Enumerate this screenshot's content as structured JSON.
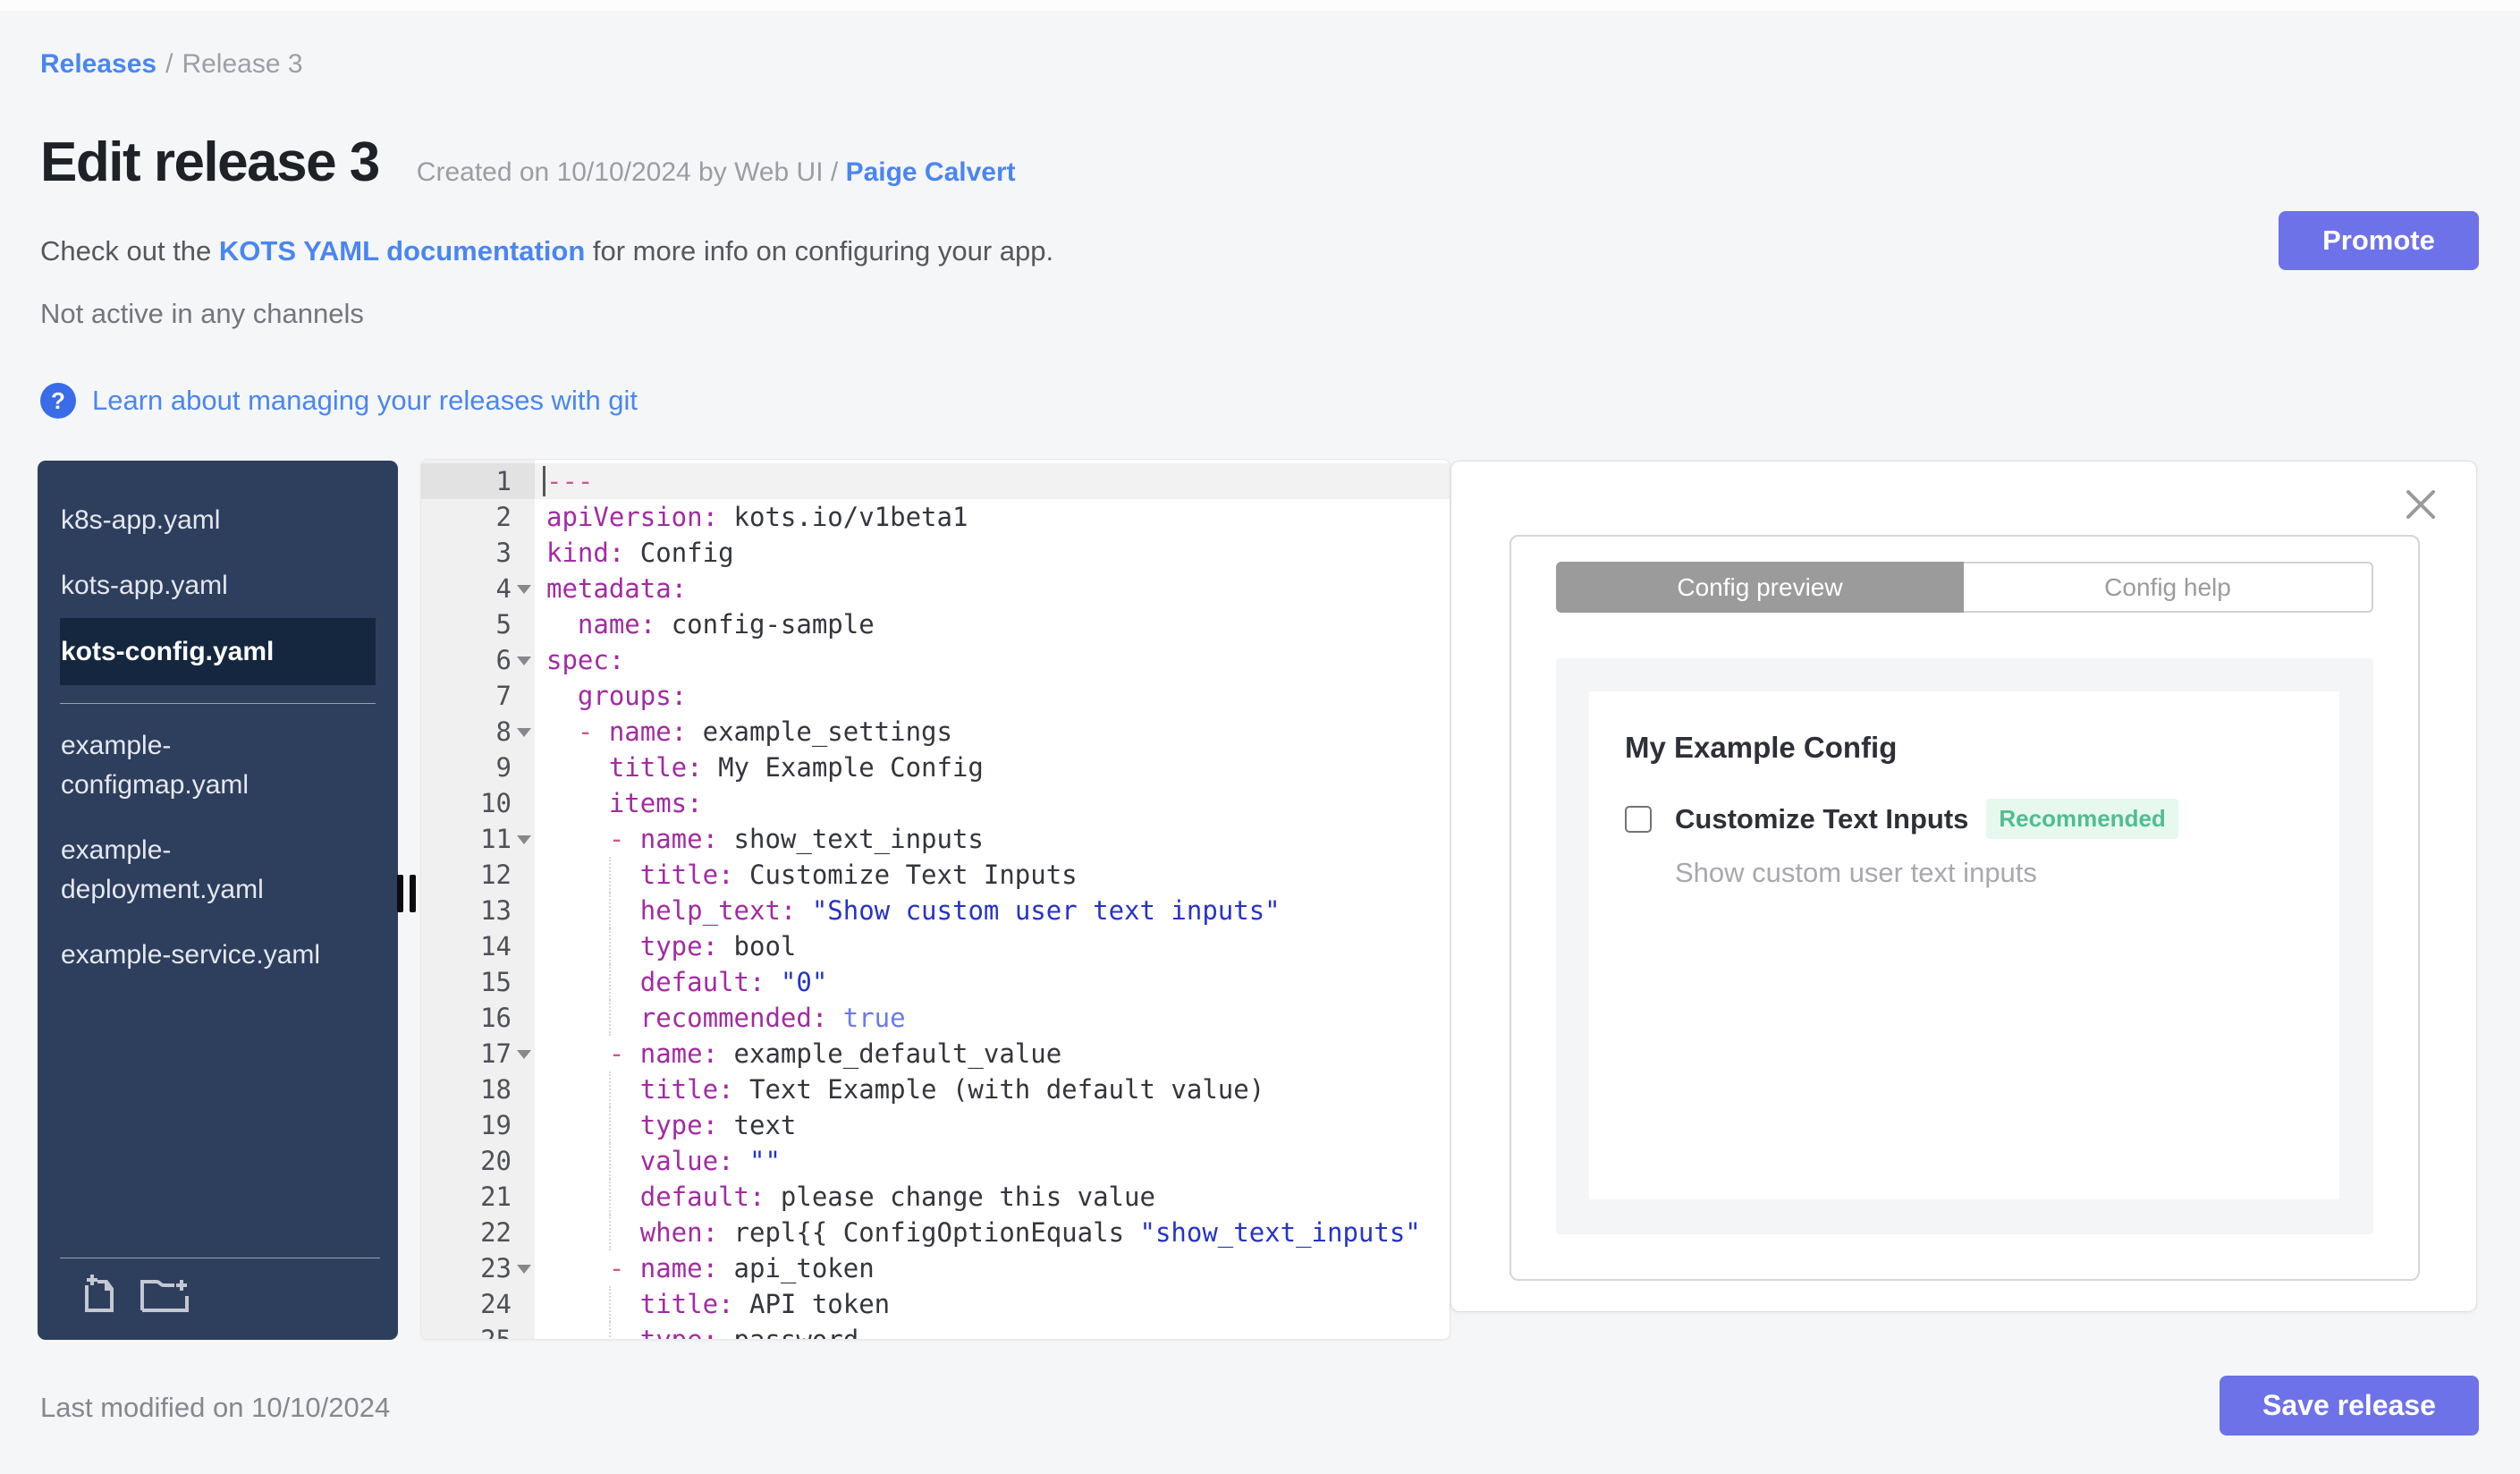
{
  "breadcrumb": {
    "link": "Releases",
    "separator": "/",
    "current": "Release 3"
  },
  "header": {
    "title": "Edit release 3",
    "created_prefix": "Created on 10/10/2024 by Web UI / ",
    "created_author": "Paige Calvert",
    "docs_prefix": "Check out the ",
    "docs_link": "KOTS YAML documentation",
    "docs_suffix": " for more info on configuring your app.",
    "channel_status": "Not active in any channels",
    "help_icon": "?",
    "git_link": "Learn about managing your releases with git",
    "promote_label": "Promote"
  },
  "sidebar": {
    "files": [
      {
        "label": "k8s-app.yaml",
        "lines": [
          "k8s-app.yaml"
        ],
        "selected": false,
        "divider_after": false
      },
      {
        "label": "kots-app.yaml",
        "lines": [
          "kots-app.yaml"
        ],
        "selected": false,
        "divider_after": false
      },
      {
        "label": "kots-config.yaml",
        "lines": [
          "kots-config.yaml"
        ],
        "selected": true,
        "divider_after": true
      },
      {
        "label": "example-configmap.yaml",
        "lines": [
          "example-",
          "configmap.yaml"
        ],
        "selected": false,
        "divider_after": false
      },
      {
        "label": "example-deployment.yaml",
        "lines": [
          "example-",
          "deployment.yaml"
        ],
        "selected": false,
        "divider_after": false
      },
      {
        "label": "example-service.yaml",
        "lines": [
          "example-service.yaml"
        ],
        "selected": false,
        "divider_after": false
      }
    ],
    "icons": [
      {
        "name": "add-file-icon"
      },
      {
        "name": "add-folder-icon"
      }
    ]
  },
  "editor": {
    "lines": [
      {
        "fold": false,
        "active": true,
        "guide": false,
        "tokens": [
          [
            "doc",
            "---"
          ]
        ]
      },
      {
        "fold": false,
        "active": false,
        "guide": false,
        "tokens": [
          [
            "key",
            "apiVersion:"
          ],
          [
            "plain",
            " kots.io/v1beta1"
          ]
        ]
      },
      {
        "fold": false,
        "active": false,
        "guide": false,
        "tokens": [
          [
            "key",
            "kind:"
          ],
          [
            "plain",
            " Config"
          ]
        ]
      },
      {
        "fold": true,
        "active": false,
        "guide": false,
        "tokens": [
          [
            "key",
            "metadata:"
          ]
        ]
      },
      {
        "fold": false,
        "active": false,
        "guide": false,
        "tokens": [
          [
            "plain",
            "  "
          ],
          [
            "key",
            "name:"
          ],
          [
            "plain",
            " config-sample"
          ]
        ]
      },
      {
        "fold": true,
        "active": false,
        "guide": false,
        "tokens": [
          [
            "key",
            "spec:"
          ]
        ]
      },
      {
        "fold": false,
        "active": false,
        "guide": false,
        "tokens": [
          [
            "plain",
            "  "
          ],
          [
            "key",
            "groups:"
          ]
        ]
      },
      {
        "fold": true,
        "active": false,
        "guide": false,
        "tokens": [
          [
            "plain",
            "  "
          ],
          [
            "dash",
            "- "
          ],
          [
            "key",
            "name:"
          ],
          [
            "plain",
            " example_settings"
          ]
        ]
      },
      {
        "fold": false,
        "active": false,
        "guide": false,
        "tokens": [
          [
            "plain",
            "    "
          ],
          [
            "key",
            "title:"
          ],
          [
            "plain",
            " My Example Config"
          ]
        ]
      },
      {
        "fold": false,
        "active": false,
        "guide": false,
        "tokens": [
          [
            "plain",
            "    "
          ],
          [
            "key",
            "items:"
          ]
        ]
      },
      {
        "fold": true,
        "active": false,
        "guide": false,
        "tokens": [
          [
            "plain",
            "    "
          ],
          [
            "dash",
            "- "
          ],
          [
            "key",
            "name:"
          ],
          [
            "plain",
            " show_text_inputs"
          ]
        ]
      },
      {
        "fold": false,
        "active": false,
        "guide": true,
        "tokens": [
          [
            "plain",
            "      "
          ],
          [
            "key",
            "title:"
          ],
          [
            "plain",
            " Customize Text Inputs"
          ]
        ]
      },
      {
        "fold": false,
        "active": false,
        "guide": true,
        "tokens": [
          [
            "plain",
            "      "
          ],
          [
            "key",
            "help_text:"
          ],
          [
            "plain",
            " "
          ],
          [
            "str",
            "\"Show custom user text inputs\""
          ]
        ]
      },
      {
        "fold": false,
        "active": false,
        "guide": true,
        "tokens": [
          [
            "plain",
            "      "
          ],
          [
            "key",
            "type:"
          ],
          [
            "plain",
            " bool"
          ]
        ]
      },
      {
        "fold": false,
        "active": false,
        "guide": true,
        "tokens": [
          [
            "plain",
            "      "
          ],
          [
            "key",
            "default:"
          ],
          [
            "plain",
            " "
          ],
          [
            "str",
            "\"0\""
          ]
        ]
      },
      {
        "fold": false,
        "active": false,
        "guide": true,
        "tokens": [
          [
            "plain",
            "      "
          ],
          [
            "key",
            "recommended:"
          ],
          [
            "plain",
            " "
          ],
          [
            "bool",
            "true"
          ]
        ]
      },
      {
        "fold": true,
        "active": false,
        "guide": false,
        "tokens": [
          [
            "plain",
            "    "
          ],
          [
            "dash",
            "- "
          ],
          [
            "key",
            "name:"
          ],
          [
            "plain",
            " example_default_value"
          ]
        ]
      },
      {
        "fold": false,
        "active": false,
        "guide": true,
        "tokens": [
          [
            "plain",
            "      "
          ],
          [
            "key",
            "title:"
          ],
          [
            "plain",
            " Text Example (with default value)"
          ]
        ]
      },
      {
        "fold": false,
        "active": false,
        "guide": true,
        "tokens": [
          [
            "plain",
            "      "
          ],
          [
            "key",
            "type:"
          ],
          [
            "plain",
            " text"
          ]
        ]
      },
      {
        "fold": false,
        "active": false,
        "guide": true,
        "tokens": [
          [
            "plain",
            "      "
          ],
          [
            "key",
            "value:"
          ],
          [
            "plain",
            " "
          ],
          [
            "str",
            "\"\""
          ]
        ]
      },
      {
        "fold": false,
        "active": false,
        "guide": true,
        "tokens": [
          [
            "plain",
            "      "
          ],
          [
            "key",
            "default:"
          ],
          [
            "plain",
            " please change this value"
          ]
        ]
      },
      {
        "fold": false,
        "active": false,
        "guide": true,
        "tokens": [
          [
            "plain",
            "      "
          ],
          [
            "key",
            "when:"
          ],
          [
            "plain",
            " repl{{ ConfigOptionEquals "
          ],
          [
            "str",
            "\"show_text_inputs\""
          ]
        ]
      },
      {
        "fold": true,
        "active": false,
        "guide": false,
        "tokens": [
          [
            "plain",
            "    "
          ],
          [
            "dash",
            "- "
          ],
          [
            "key",
            "name:"
          ],
          [
            "plain",
            " api_token"
          ]
        ]
      },
      {
        "fold": false,
        "active": false,
        "guide": true,
        "tokens": [
          [
            "plain",
            "      "
          ],
          [
            "key",
            "title:"
          ],
          [
            "plain",
            " API token"
          ]
        ]
      },
      {
        "fold": false,
        "active": false,
        "guide": true,
        "tokens": [
          [
            "plain",
            "      "
          ],
          [
            "key",
            "type:"
          ],
          [
            "plain",
            " password"
          ]
        ]
      }
    ]
  },
  "preview": {
    "tabs": [
      {
        "label": "Config preview",
        "active": true
      },
      {
        "label": "Config help",
        "active": false
      }
    ],
    "config_card": {
      "group_title": "My Example Config",
      "item_label": "Customize Text Inputs",
      "item_checked": false,
      "badge": "Recommended",
      "item_help": "Show custom user text inputs"
    }
  },
  "footer": {
    "last_modified": "Last modified on 10/10/2024",
    "save_label": "Save release"
  },
  "colors": {
    "accent_purple": "#6e72e9",
    "link_blue": "#4a86f0",
    "help_icon_blue": "#3a6be8",
    "sidebar_navy": "#2e3e5d",
    "sidebar_selected_navy": "#15263f",
    "badge_green_text": "#4fbe8e",
    "badge_green_bg": "#e7f8ef",
    "tab_active_gray": "#9b9b9b",
    "yaml_key": "#a22ba2",
    "yaml_string": "#2633c7",
    "yaml_bool": "#6b79ea",
    "yaml_doc_separator": "#d25691"
  }
}
